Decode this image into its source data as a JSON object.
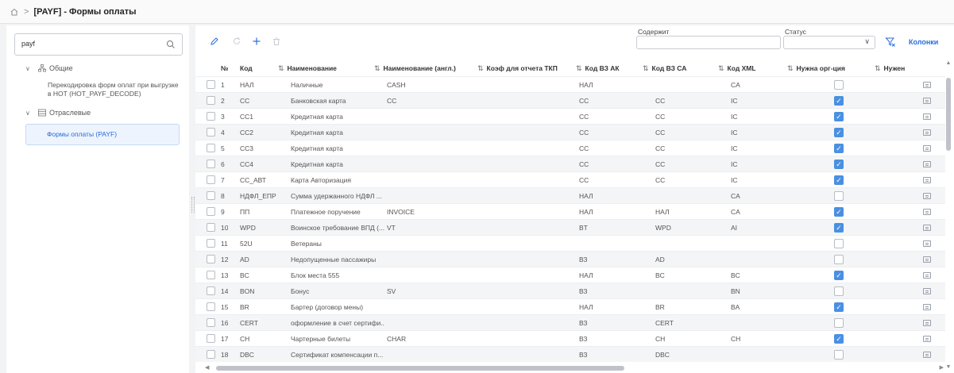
{
  "breadcrumb": {
    "title": "[PAYF] - Формы оплаты"
  },
  "sidebar": {
    "search_value": "payf",
    "groups": [
      {
        "label": "Общие",
        "items": [
          {
            "label": "Перекодировка форм оплат при выгрузке в НОТ (HOT_PAYF_DECODE)"
          }
        ]
      },
      {
        "label": "Отраслевые",
        "items": [
          {
            "label": "Формы оплаты (PAYF)",
            "selected": true
          }
        ]
      }
    ]
  },
  "filters": {
    "contains_label": "Содержит",
    "contains_value": "",
    "status_label": "Статус",
    "status_value": "",
    "columns_label": "Колонки"
  },
  "table": {
    "headers": [
      "№",
      "Код",
      "Наименование",
      "Наименование (англ.)",
      "Коэф для отчета ТКП",
      "Код ВЗ АК",
      "Код ВЗ СА",
      "Код XML",
      "Нужна орг-ция",
      "Нужен"
    ],
    "rows": [
      {
        "n": "1",
        "code": "НАЛ",
        "name": "Наличные",
        "name_en": "CASH",
        "koef": "",
        "vz_ak": "НАЛ",
        "vz_ca": "",
        "xml": "CA",
        "org": false
      },
      {
        "n": "2",
        "code": "CC",
        "name": "Банковская карта",
        "name_en": "CC",
        "koef": "",
        "vz_ak": "CC",
        "vz_ca": "CC",
        "xml": "IC",
        "org": true
      },
      {
        "n": "3",
        "code": "CC1",
        "name": "Кредитная карта",
        "name_en": "",
        "koef": "",
        "vz_ak": "CC",
        "vz_ca": "CC",
        "xml": "IC",
        "org": true
      },
      {
        "n": "4",
        "code": "CC2",
        "name": "Кредитная карта",
        "name_en": "",
        "koef": "",
        "vz_ak": "CC",
        "vz_ca": "CC",
        "xml": "IC",
        "org": true
      },
      {
        "n": "5",
        "code": "CC3",
        "name": "Кредитная карта",
        "name_en": "",
        "koef": "",
        "vz_ak": "CC",
        "vz_ca": "CC",
        "xml": "IC",
        "org": true
      },
      {
        "n": "6",
        "code": "CC4",
        "name": "Кредитная карта",
        "name_en": "",
        "koef": "",
        "vz_ak": "CC",
        "vz_ca": "CC",
        "xml": "IC",
        "org": true
      },
      {
        "n": "7",
        "code": "CC_АВТ",
        "name": "Карта Авторизация",
        "name_en": "",
        "koef": "",
        "vz_ak": "CC",
        "vz_ca": "CC",
        "xml": "IC",
        "org": true
      },
      {
        "n": "8",
        "code": "НДФЛ_ЕПР",
        "name": "Сумма удержанного НДФЛ ...",
        "name_en": "",
        "koef": "",
        "vz_ak": "НАЛ",
        "vz_ca": "",
        "xml": "CA",
        "org": false
      },
      {
        "n": "9",
        "code": "ПП",
        "name": "Платежное поручение",
        "name_en": "INVOICE",
        "koef": "",
        "vz_ak": "НАЛ",
        "vz_ca": "НАЛ",
        "xml": "CA",
        "org": true
      },
      {
        "n": "10",
        "code": "WPD",
        "name": "Воинское требование ВПД (...",
        "name_en": "VT",
        "koef": "",
        "vz_ak": "BT",
        "vz_ca": "WPD",
        "xml": "AI",
        "org": true
      },
      {
        "n": "11",
        "code": "52U",
        "name": "Ветераны",
        "name_en": "",
        "koef": "",
        "vz_ak": "",
        "vz_ca": "",
        "xml": "",
        "org": false
      },
      {
        "n": "12",
        "code": "AD",
        "name": "Недопущенные пассажиры",
        "name_en": "",
        "koef": "",
        "vz_ak": "ВЗ",
        "vz_ca": "AD",
        "xml": "",
        "org": false
      },
      {
        "n": "13",
        "code": "BC",
        "name": "Блок места 555",
        "name_en": "",
        "koef": "",
        "vz_ak": "НАЛ",
        "vz_ca": "BC",
        "xml": "BC",
        "org": true
      },
      {
        "n": "14",
        "code": "BON",
        "name": "Бонус",
        "name_en": "SV",
        "koef": "",
        "vz_ak": "ВЗ",
        "vz_ca": "",
        "xml": "BN",
        "org": false
      },
      {
        "n": "15",
        "code": "BR",
        "name": "Бартер (договор мены)",
        "name_en": "",
        "koef": "",
        "vz_ak": "НАЛ",
        "vz_ca": "BR",
        "xml": "BA",
        "org": true
      },
      {
        "n": "16",
        "code": "CERT",
        "name": "оформление в счет сертифи...",
        "name_en": "",
        "koef": "",
        "vz_ak": "ВЗ",
        "vz_ca": "CERT",
        "xml": "",
        "org": false
      },
      {
        "n": "17",
        "code": "CH",
        "name": "Чартерные билеты",
        "name_en": "CHAR",
        "koef": "",
        "vz_ak": "ВЗ",
        "vz_ca": "CH",
        "xml": "CH",
        "org": true
      },
      {
        "n": "18",
        "code": "DBC",
        "name": "Сертификат компенсации п...",
        "name_en": "",
        "koef": "",
        "vz_ak": "ВЗ",
        "vz_ca": "DBC",
        "xml": "",
        "org": false
      }
    ]
  }
}
